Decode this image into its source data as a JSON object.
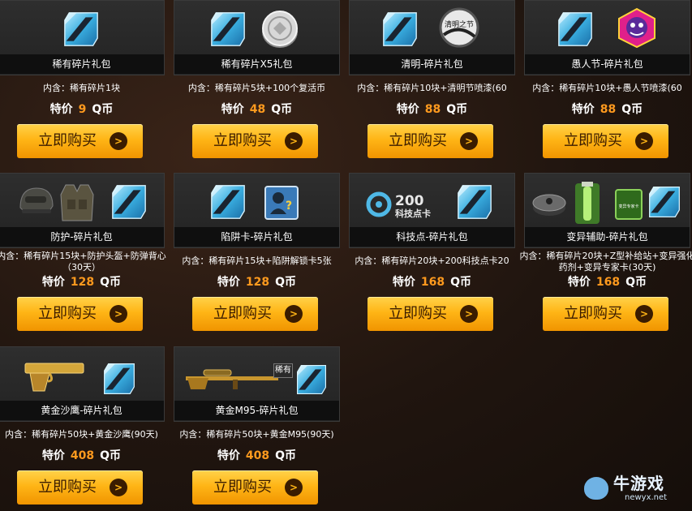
{
  "buy_label": "立即购买",
  "price_label": "特价",
  "currency": "Q币",
  "cards": [
    {
      "name": "稀有碎片礼包",
      "desc": "内含：稀有碎片1块",
      "price": "9"
    },
    {
      "name": "稀有碎片X5礼包",
      "desc": "内含：稀有碎片5块+100个复活币",
      "price": "48"
    },
    {
      "name": "清明-碎片礼包",
      "desc": "内含：稀有碎片10块+清明节喷漆(60",
      "price": "88"
    },
    {
      "name": "愚人节-碎片礼包",
      "desc": "内含：稀有碎片10块+愚人节喷漆(60",
      "price": "88"
    },
    {
      "name": "防护-碎片礼包",
      "desc": "内含：稀有碎片15块+防护头盔+防弹背心（30天）",
      "price": "128"
    },
    {
      "name": "陷阱卡-碎片礼包",
      "desc": "内含：稀有碎片15块+陷阱解锁卡5张",
      "price": "128"
    },
    {
      "name": "科技点-碎片礼包",
      "desc": "内含：稀有碎片20块+200科技点卡20",
      "price": "168"
    },
    {
      "name": "变异辅助-碎片礼包",
      "desc": "内含：稀有碎片20块+Z型补给站+变异强化药剂+变异专家卡(30天)",
      "price": "168"
    },
    {
      "name": "黄金沙鹰-碎片礼包",
      "desc": "内含：稀有碎片50块+黄金沙鹰(90天)",
      "price": "408"
    },
    {
      "name": "黄金M95-碎片礼包",
      "desc": "内含：稀有碎片50块+黄金M95(90天)",
      "price": "408"
    }
  ],
  "icon_text": {
    "qingming": "清明之节",
    "tech_number": "200",
    "tech_caption": "科技点卡",
    "expert_card": "变异专家卡",
    "rare_tag": "稀有"
  },
  "watermark": {
    "name": "牛游戏",
    "url": "newyx.net"
  },
  "colors": {
    "accent": "#ff9a1e",
    "button": "#ffb516",
    "shard": "#4fb8e6"
  }
}
